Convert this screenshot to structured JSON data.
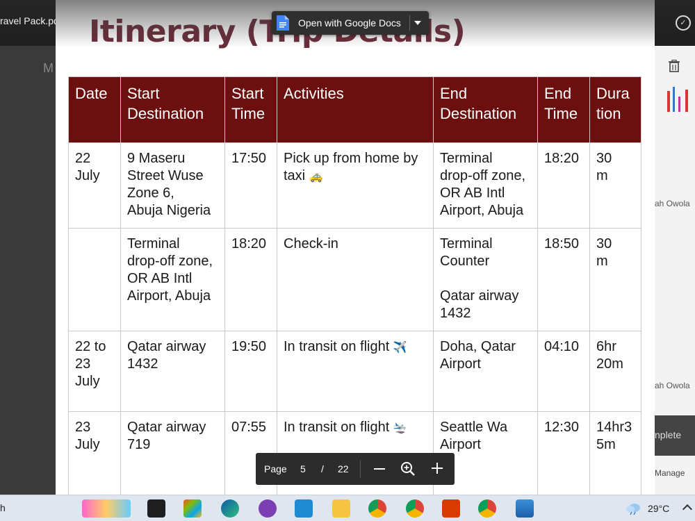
{
  "window": {
    "file_name": "ravel Pack.pdf",
    "open_with_label": "Open with Google Docs"
  },
  "background_app": {
    "left_letter": "M",
    "snippet_1": "ah Owola",
    "snippet_2": "ah Owola",
    "complete_label": "nplete",
    "manage_label": "Manage"
  },
  "page": {
    "title": "Itinerary (Trip Details)"
  },
  "itinerary": {
    "headers": [
      "Date",
      "Start\nDestination",
      "Start\nTime",
      "Activities",
      "End\nDestination",
      "End\nTime",
      "Dura\ntion"
    ],
    "rows": [
      {
        "date": "22\nJuly",
        "start_destination": "9 Maseru\nStreet Wuse\nZone 6,\nAbuja Nigeria",
        "start_time": "17:50",
        "activity": "Pick up from home by\ntaxi",
        "activity_emoji": "🚕",
        "end_destination": "Terminal\ndrop-off zone,\nOR AB Intl\nAirport, Abuja",
        "end_time": "18:20",
        "duration": "30\nm"
      },
      {
        "date": "",
        "start_destination": "Terminal\ndrop-off zone,\nOR AB Intl\nAirport, Abuja",
        "start_time": "18:20",
        "activity": "Check-in",
        "activity_emoji": "",
        "end_destination": "Terminal\nCounter\n\nQatar airway\n1432",
        "end_time": "18:50",
        "duration": "30\nm"
      },
      {
        "date": "22 to\n23\nJuly",
        "start_destination": "Qatar airway\n1432",
        "start_time": "19:50",
        "activity": "In transit on flight",
        "activity_emoji": "✈️",
        "end_destination": "Doha, Qatar\nAirport",
        "end_time": "04:10",
        "duration": "6hr\n20m"
      },
      {
        "date": "23\nJuly",
        "start_destination": "Qatar airway\n719",
        "start_time": "07:55",
        "activity": "In transit on flight",
        "activity_emoji": "🛬",
        "end_destination": "Seattle Wa\nAirport",
        "end_time": "12:30",
        "duration": "14hr3\n5m"
      }
    ]
  },
  "page_nav": {
    "label": "Page",
    "current": "5",
    "separator": "/",
    "total": "22"
  },
  "taskbar": {
    "left_text": "h",
    "temperature": "29°C",
    "icons": [
      "widgets-icon",
      "terminal-icon",
      "store-icon",
      "edge-icon",
      "github-icon",
      "vscode-icon",
      "file-explorer-icon",
      "chrome-profile-icon",
      "chrome-profile-b-icon",
      "office-icon",
      "chrome-active-icon",
      "photos-icon"
    ]
  },
  "colors": {
    "header_bg": "#6b0f0f",
    "title_color": "#6b2c3a"
  }
}
